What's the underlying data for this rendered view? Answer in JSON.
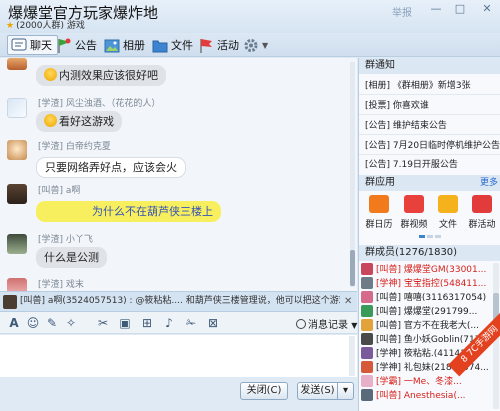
{
  "window": {
    "title": "爆爆堂官方玩家爆炸地",
    "subtitle": "(2000人群) 游戏",
    "report": "举报",
    "min": "—",
    "max": "□",
    "close": "✕"
  },
  "toolbar": {
    "chat": "聊天",
    "notice": "公告",
    "album": "相册",
    "file": "文件",
    "activity": "活动"
  },
  "messages": [
    {
      "meta": "",
      "text": "内测效果应该很好吧",
      "style": "grey",
      "emoji": true
    },
    {
      "meta": "[学渣] 风尘浊酒、（花花的人）",
      "text": "看好这游戏",
      "style": "grey",
      "emoji": true
    },
    {
      "meta": "[学渣] 白帝约克夏",
      "text": "只要网络弄好点，应该会火",
      "style": "white",
      "emoji": false
    },
    {
      "meta": "[叫兽] a啊",
      "text": "为什么不在葫芦侠三楼上",
      "style": "yellow",
      "emoji": false
    },
    {
      "meta": "[学渣] 小丫飞",
      "text": "什么是公测",
      "style": "grey",
      "emoji": false
    },
    {
      "meta": "[学渣] 戏末",
      "text": "",
      "style": "grey",
      "emoji": false
    }
  ],
  "pinned": {
    "text": "[叫兽] a啊(3524057513) : @筱粘粘.... 和葫芦侠三楼管理说，他可以把这个游戏推...",
    "close": "✕"
  },
  "input_toolbar": {
    "history": "消息记录"
  },
  "send_bar": {
    "close": "关闭(C)",
    "send": "发送(S)",
    "dropdown": "▾"
  },
  "group_notice": {
    "title": "群通知",
    "items": [
      "[相册] 《群相册》新增3张",
      "[投票] 你喜欢谁",
      "[公告] 维护结束公告",
      "[公告] 7月20日临时停机维护公告",
      "[公告] 7.19日开服公告"
    ]
  },
  "group_apps": {
    "title": "群应用",
    "more": "更多",
    "items": [
      {
        "label": "群日历",
        "icon": "calendar-icon",
        "color": "#f07a1c"
      },
      {
        "label": "群视频",
        "icon": "video-icon",
        "color": "#e8403a"
      },
      {
        "label": "文件",
        "icon": "folder-icon",
        "color": "#f5b21d"
      },
      {
        "label": "群活动",
        "icon": "flag-icon",
        "color": "#e23b3b"
      }
    ]
  },
  "members": {
    "title": "群成员(1276/1830)",
    "list": [
      {
        "text": "[叫兽] 爆爆堂GM(33001...",
        "color": "red"
      },
      {
        "text": "[学神] 宝宝指控(548411...",
        "color": "red"
      },
      {
        "text": "[叫兽] 嘻嘻(3116317054)",
        "color": "black"
      },
      {
        "text": "[叫兽] 爆爆堂(291799...",
        "color": "black"
      },
      {
        "text": "[叫兽] 官方不在我老大(...",
        "color": "black"
      },
      {
        "text": "[叫兽] 鱼小妖Goblin(717...",
        "color": "black"
      },
      {
        "text": "[学神] 筱粘粘.(41141....",
        "color": "black"
      },
      {
        "text": "[学神] 礼包妹(21842574...",
        "color": "black"
      },
      {
        "text": "[学霸] 一Me、冬漆...",
        "color": "red"
      },
      {
        "text": "[叫兽] Anesthesia(...",
        "color": "red"
      }
    ]
  },
  "watermark": "8 7C手游网"
}
